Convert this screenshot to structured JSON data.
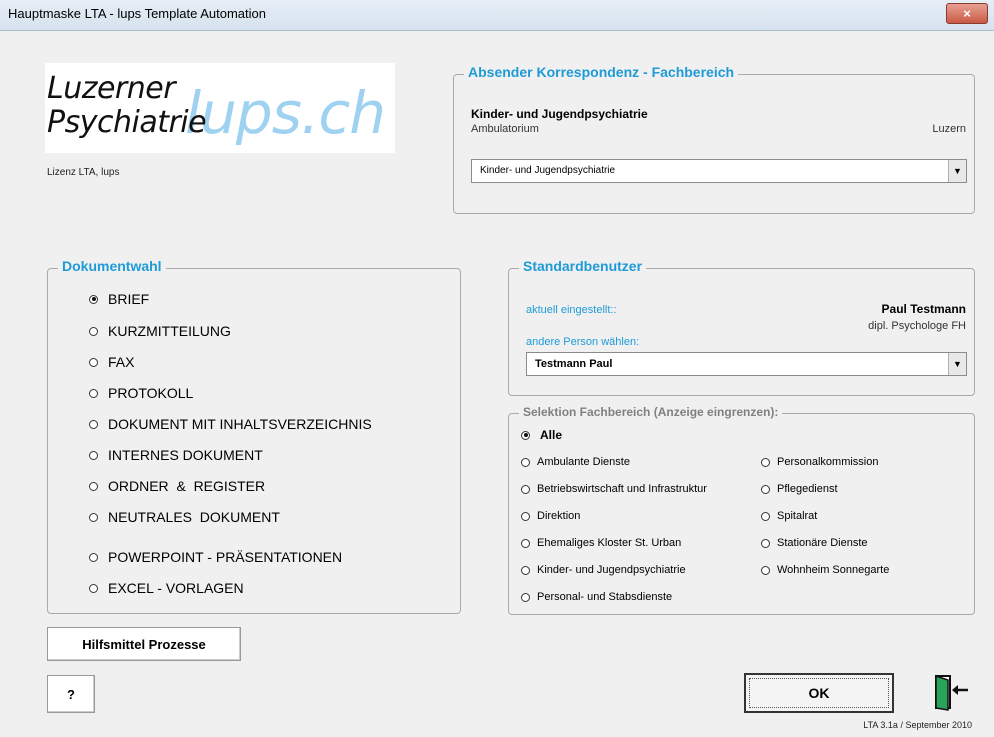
{
  "window": {
    "title": "Hauptmaske LTA - lups Template Automation",
    "close_label": "×"
  },
  "logo": {
    "line1": "Luzerner",
    "line2": "Psychiatrie",
    "brand": "lups.ch"
  },
  "lizenz": "Lizenz LTA, lups",
  "absender": {
    "title": "Absender Korrespondenz - Fachbereich",
    "name": "Kinder- und Jugendpsychiatrie",
    "sub": "Ambulatorium",
    "location": "Luzern",
    "combo_value": "Kinder- und Jugendpsychiatrie",
    "combo_arrow": "▼"
  },
  "dokumentwahl": {
    "title": "Dokumentwahl",
    "options": [
      {
        "label": "BRIEF",
        "selected": true
      },
      {
        "label": "KURZMITTEILUNG",
        "selected": false
      },
      {
        "label": "FAX",
        "selected": false
      },
      {
        "label": "PROTOKOLL",
        "selected": false
      },
      {
        "label": "DOKUMENT MIT INHALTSVERZEICHNIS",
        "selected": false
      },
      {
        "label": "INTERNES DOKUMENT",
        "selected": false
      },
      {
        "label": "ORDNER  &  REGISTER",
        "selected": false
      },
      {
        "label": "NEUTRALES  DOKUMENT",
        "selected": false
      },
      {
        "label": "POWERPOINT - PRÄSENTATIONEN",
        "selected": false
      },
      {
        "label": "EXCEL - VORLAGEN",
        "selected": false
      }
    ]
  },
  "standardbenutzer": {
    "title": "Standardbenutzer",
    "current_label": "aktuell eingestellt::",
    "current_name": "Paul Testmann",
    "current_role": "dipl. Psychologe FH",
    "other_label": "andere Person wählen:",
    "combo_value": "Testmann Paul",
    "combo_arrow": "▼"
  },
  "selektion": {
    "title": "Selektion Fachbereich (Anzeige eingrenzen):",
    "alle": "Alle",
    "left": [
      "Ambulante Dienste",
      "Betriebswirtschaft und Infrastruktur",
      "Direktion",
      "Ehemaliges Kloster St. Urban",
      "Kinder- und Jugendpsychiatrie",
      "Personal- und Stabsdienste"
    ],
    "right": [
      "Personalkommission",
      "Pflegedienst",
      "Spitalrat",
      "Stationäre Dienste",
      "Wohnheim Sonnegarte"
    ]
  },
  "buttons": {
    "hilfsmittel": "Hilfsmittel Prozesse",
    "help": "?",
    "ok": "OK"
  },
  "version": "LTA 3.1a / September 2010",
  "colors": {
    "accent": "#1e9bd7",
    "logo_blue": "#9fd2f0"
  }
}
